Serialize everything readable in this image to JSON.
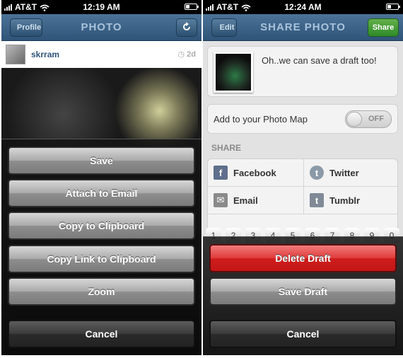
{
  "status_left": {
    "carrier": "AT&T",
    "time": "12:19 AM"
  },
  "status_right": {
    "carrier": "AT&T",
    "time": "12:24 AM"
  },
  "left": {
    "nav": {
      "back_label": "Profile",
      "title": "PHOTO"
    },
    "post": {
      "username": "skrram",
      "age": "2d"
    },
    "sheet": {
      "buttons": [
        "Save",
        "Attach to Email",
        "Copy to Clipboard",
        "Copy Link to Clipboard",
        "Zoom"
      ],
      "cancel": "Cancel"
    }
  },
  "right": {
    "nav": {
      "back_label": "Edit",
      "title": "SHARE PHOTO",
      "share_label": "Share"
    },
    "caption": "Oh..we can save a draft too!",
    "photo_map": {
      "label": "Add to your Photo Map",
      "toggle": "OFF"
    },
    "share_heading": "SHARE",
    "share_services": [
      {
        "label": "Facebook",
        "icon": "facebook-icon",
        "glyph": "f"
      },
      {
        "label": "Twitter",
        "icon": "twitter-icon",
        "glyph": "t"
      },
      {
        "label": "Email",
        "icon": "mail-icon",
        "glyph": "✉"
      },
      {
        "label": "Tumblr",
        "icon": "tumblr-icon",
        "glyph": "t"
      }
    ],
    "keys": [
      "1",
      "2",
      "3",
      "4",
      "5",
      "6",
      "7",
      "8",
      "9",
      "0"
    ],
    "sheet": {
      "delete": "Delete Draft",
      "save": "Save Draft",
      "cancel": "Cancel"
    }
  }
}
